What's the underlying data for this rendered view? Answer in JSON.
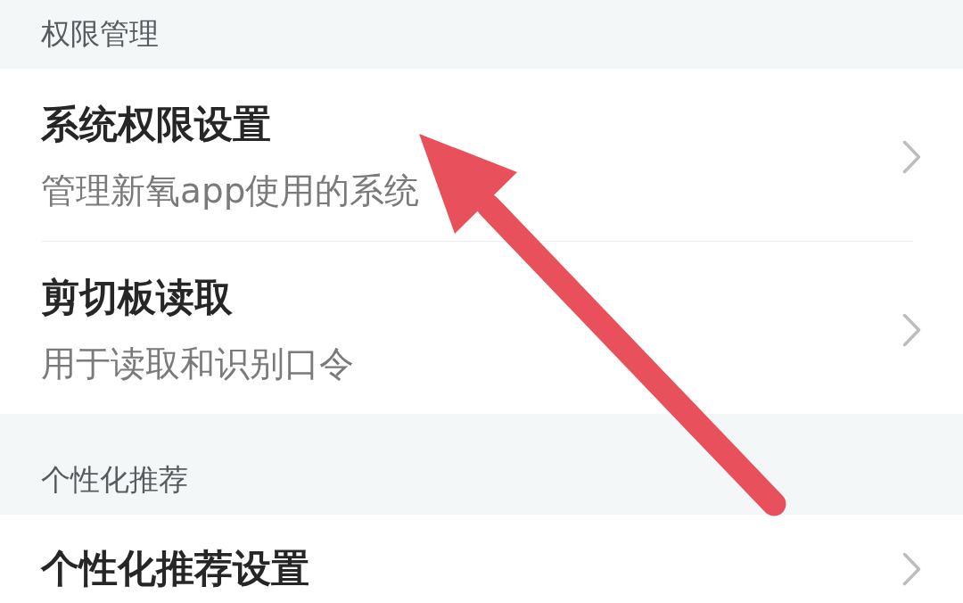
{
  "sections": [
    {
      "header": "权限管理",
      "items": [
        {
          "title": "系统权限设置",
          "subtitle": "管理新氧app使用的系统"
        },
        {
          "title": "剪切板读取",
          "subtitle": "用于读取和识别口令"
        }
      ]
    },
    {
      "header": "个性化推荐",
      "items": [
        {
          "title": "个性化推荐设置"
        }
      ]
    }
  ]
}
